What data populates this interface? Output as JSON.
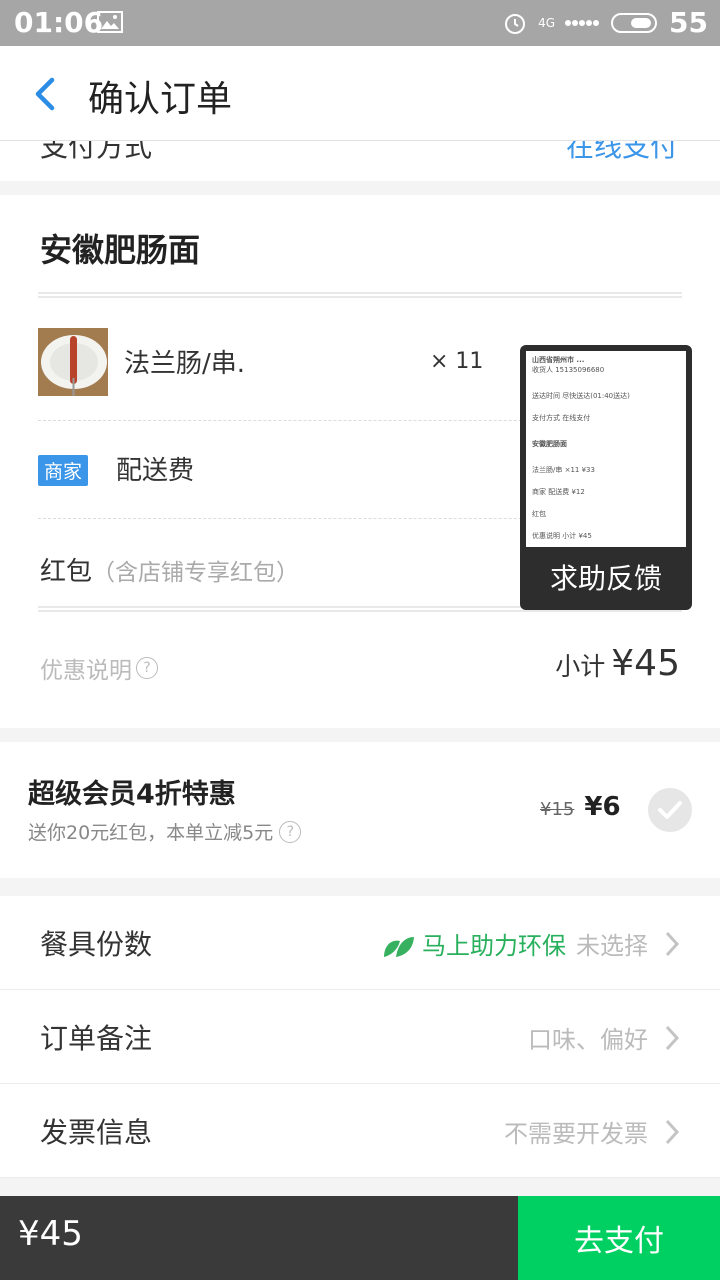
{
  "status_bar": {
    "time": "01:06",
    "network": "4G",
    "battery": "55"
  },
  "header": {
    "title": "确认订单"
  },
  "ghost_row": {
    "label": "支付方式",
    "value": "在线支付"
  },
  "order": {
    "shop_name": "安徽肥肠面",
    "item": {
      "name": "法兰肠/串.",
      "quantity": "× 11"
    },
    "delivery": {
      "tag": "商家",
      "label": "配送费"
    },
    "redpacket": {
      "label": "红包",
      "sub": "（含店铺专享红包）"
    },
    "promo": {
      "label": "优惠说明",
      "help": "?"
    },
    "subtotal": {
      "label": "小计",
      "amount": "¥45"
    }
  },
  "feedback_overlay": {
    "label": "求助反馈",
    "mini_lines": [
      "山西省朔州市 ...",
      "收货人 15135096680",
      "送达时间 尽快送达(01:40送达)",
      "支付方式 在线支付",
      "安徽肥肠面",
      "法兰肠/串 ×11 ¥33",
      "商家 配送费 ¥12",
      "红包",
      "优惠说明 小计 ¥45"
    ]
  },
  "vip": {
    "title": "超级会员4折特惠",
    "subtitle": "送你20元红包，本单立减5元",
    "help": "?",
    "old_price": "¥15",
    "new_price": "¥6"
  },
  "options": [
    {
      "label": "餐具份数",
      "green": "马上助力环保",
      "value": "未选择"
    },
    {
      "label": "订单备注",
      "green": "",
      "value": "口味、偏好"
    },
    {
      "label": "发票信息",
      "green": "",
      "value": "不需要开发票"
    }
  ],
  "footer": {
    "total": "¥45",
    "pay_label": "去支付"
  },
  "colors": {
    "accent_blue": "#3b95e8",
    "pay_green": "#00d062",
    "eco_green": "#28b05c",
    "dark_bar": "#3a3a3a"
  }
}
